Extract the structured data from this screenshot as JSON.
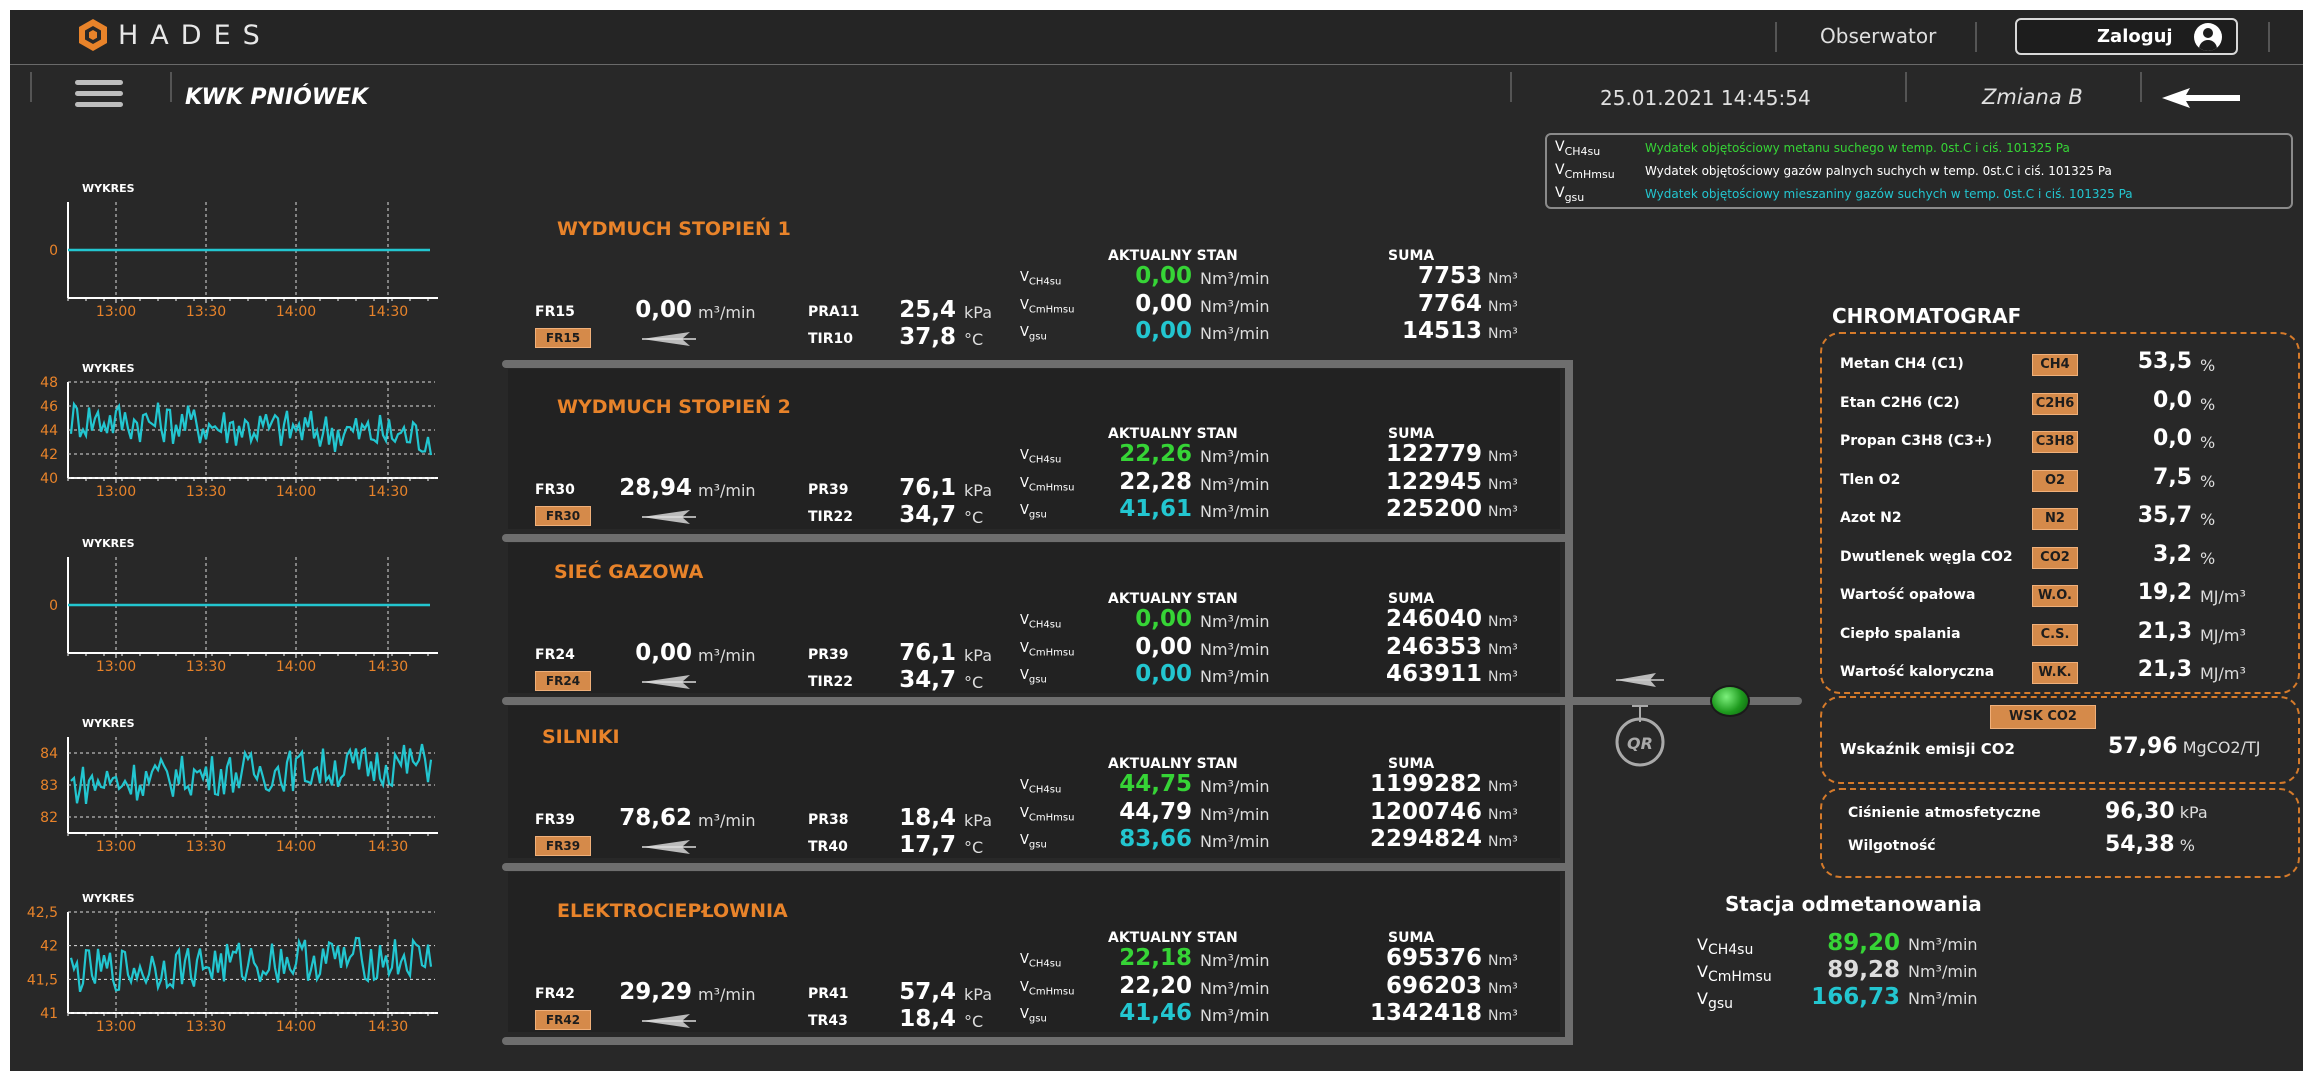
{
  "header": {
    "logo_text": "HADES",
    "role": "Obserwator",
    "login_label": "Zaloguj"
  },
  "subbar": {
    "mine": "KWK PNIÓWEK",
    "datetime": "25.01.2021 14:45:54",
    "shift": "Zmiana B"
  },
  "legend": [
    {
      "sym": "V",
      "sub": "CH4su",
      "text": "Wydatek objętościowy metanu suchego w temp. 0st.C i ciś. 101325 Pa",
      "color": "#36d436"
    },
    {
      "sym": "V",
      "sub": "CmHmsu",
      "text": "Wydatek objętościowy gazów palnych suchych w temp. 0st.C i ciś. 101325 Pa",
      "color": "#ffffff"
    },
    {
      "sym": "V",
      "sub": "gsu",
      "text": "Wydatek objętościowy mieszaniny gazów suchych w temp. 0st.C i ciś. 101325 Pa",
      "color": "#23c6d0"
    }
  ],
  "charts": [
    {
      "title": "WYKRES",
      "ticks_x": [
        "13:00",
        "13:30",
        "14:00",
        "14:30"
      ],
      "ticks_y": [
        "0"
      ]
    },
    {
      "title": "WYKRES",
      "ticks_x": [
        "13:00",
        "13:30",
        "14:00",
        "14:30"
      ],
      "ticks_y": [
        "48",
        "46",
        "44",
        "42",
        "40"
      ]
    },
    {
      "title": "WYKRES",
      "ticks_x": [
        "13:00",
        "13:30",
        "14:00",
        "14:30"
      ],
      "ticks_y": [
        "0"
      ]
    },
    {
      "title": "WYKRES",
      "ticks_x": [
        "13:00",
        "13:30",
        "14:00",
        "14:30"
      ],
      "ticks_y": [
        "84",
        "83",
        "82"
      ]
    },
    {
      "title": "WYKRES",
      "ticks_x": [
        "13:00",
        "13:30",
        "14:00",
        "14:30"
      ],
      "ticks_y": [
        "42,5",
        "42",
        "41,5",
        "41"
      ]
    }
  ],
  "chart_data": [
    {
      "type": "line",
      "title": "WYKRES",
      "x": [
        "13:00",
        "13:30",
        "14:00",
        "14:30"
      ],
      "ylim": [
        -1,
        1
      ],
      "series": [
        {
          "values": [
            0,
            0,
            0,
            0
          ]
        }
      ]
    },
    {
      "type": "line",
      "title": "WYKRES",
      "x": [
        "13:00",
        "13:30",
        "14:00",
        "14:30"
      ],
      "ylim": [
        40,
        48
      ],
      "series": [
        {
          "values": [
            45,
            44.5,
            44,
            43.5
          ]
        }
      ]
    },
    {
      "type": "line",
      "title": "WYKRES",
      "x": [
        "13:00",
        "13:30",
        "14:00",
        "14:30"
      ],
      "ylim": [
        -1,
        1
      ],
      "series": [
        {
          "values": [
            0,
            0,
            0,
            0
          ]
        }
      ]
    },
    {
      "type": "line",
      "title": "WYKRES",
      "x": [
        "13:00",
        "13:30",
        "14:00",
        "14:30"
      ],
      "ylim": [
        81.5,
        84.5
      ],
      "series": [
        {
          "values": [
            83,
            83.3,
            83.5,
            83.7
          ]
        }
      ]
    },
    {
      "type": "line",
      "title": "WYKRES",
      "x": [
        "13:00",
        "13:30",
        "14:00",
        "14:30"
      ],
      "ylim": [
        41,
        42.5
      ],
      "series": [
        {
          "values": [
            41.6,
            41.7,
            41.8,
            41.8
          ]
        }
      ]
    }
  ],
  "section_headers": {
    "state": "AKTUALNY STAN",
    "sum": "SUMA"
  },
  "sections": [
    {
      "title": "WYDMUCH STOPIEŃ 1",
      "flow_tag": "FR15",
      "flow_value": "0,00",
      "flow_unit": "m³/min",
      "p_tag": "PRA11",
      "p_value": "25,4",
      "p_unit": "kPa",
      "t_tag": "TIR10",
      "t_value": "37,8",
      "t_unit": "°C",
      "v_ch4": "0,00",
      "v_cm": "0,00",
      "v_gsu": "0,00",
      "v_unit": "Nm³/min",
      "s_ch4": "7753",
      "s_cm": "7764",
      "s_gsu": "14513",
      "s_unit": "Nm³"
    },
    {
      "title": "WYDMUCH STOPIEŃ 2",
      "flow_tag": "FR30",
      "flow_value": "28,94",
      "flow_unit": "m³/min",
      "p_tag": "PR39",
      "p_value": "76,1",
      "p_unit": "kPa",
      "t_tag": "TIR22",
      "t_value": "34,7",
      "t_unit": "°C",
      "v_ch4": "22,26",
      "v_cm": "22,28",
      "v_gsu": "41,61",
      "v_unit": "Nm³/min",
      "s_ch4": "122779",
      "s_cm": "122945",
      "s_gsu": "225200",
      "s_unit": "Nm³"
    },
    {
      "title": "SIEĆ GAZOWA",
      "flow_tag": "FR24",
      "flow_value": "0,00",
      "flow_unit": "m³/min",
      "p_tag": "PR39",
      "p_value": "76,1",
      "p_unit": "kPa",
      "t_tag": "TIR22",
      "t_value": "34,7",
      "t_unit": "°C",
      "v_ch4": "0,00",
      "v_cm": "0,00",
      "v_gsu": "0,00",
      "v_unit": "Nm³/min",
      "s_ch4": "246040",
      "s_cm": "246353",
      "s_gsu": "463911",
      "s_unit": "Nm³"
    },
    {
      "title": "SILNIKI",
      "flow_tag": "FR39",
      "flow_value": "78,62",
      "flow_unit": "m³/min",
      "p_tag": "PR38",
      "p_value": "18,4",
      "p_unit": "kPa",
      "t_tag": "TR40",
      "t_value": "17,7",
      "t_unit": "°C",
      "v_ch4": "44,75",
      "v_cm": "44,79",
      "v_gsu": "83,66",
      "v_unit": "Nm³/min",
      "s_ch4": "1199282",
      "s_cm": "1200746",
      "s_gsu": "2294824",
      "s_unit": "Nm³"
    },
    {
      "title": "ELEKTROCIEPŁOWNIA",
      "flow_tag": "FR42",
      "flow_value": "29,29",
      "flow_unit": "m³/min",
      "p_tag": "PR41",
      "p_value": "57,4",
      "p_unit": "kPa",
      "t_tag": "TR43",
      "t_value": "18,4",
      "t_unit": "°C",
      "v_ch4": "22,18",
      "v_cm": "22,20",
      "v_gsu": "41,46",
      "v_unit": "Nm³/min",
      "s_ch4": "695376",
      "s_cm": "696203",
      "s_gsu": "1342418",
      "s_unit": "Nm³"
    }
  ],
  "vsym": {
    "v": "V",
    "ch4": "CH4su",
    "cm": "CmHmsu",
    "gsu": "gsu"
  },
  "qr_label": "QR",
  "chromatograf": {
    "title": "CHROMATOGRAF",
    "rows": [
      {
        "label": "Metan CH4 (C1)",
        "tag": "CH4",
        "value": "53,5",
        "unit": "%"
      },
      {
        "label": "Etan C2H6 (C2)",
        "tag": "C2H6",
        "value": "0,0",
        "unit": "%"
      },
      {
        "label": "Propan C3H8 (C3+)",
        "tag": "C3H8",
        "value": "0,0",
        "unit": "%"
      },
      {
        "label": "Tlen O2",
        "tag": "O2",
        "value": "7,5",
        "unit": "%"
      },
      {
        "label": "Azot N2",
        "tag": "N2",
        "value": "35,7",
        "unit": "%"
      },
      {
        "label": "Dwutlenek węgla CO2",
        "tag": "CO2",
        "value": "3,2",
        "unit": "%"
      },
      {
        "label": "Wartość opałowa",
        "tag": "W.O.",
        "value": "19,2",
        "unit": "MJ/m³"
      },
      {
        "label": "Ciepło spalania",
        "tag": "C.S.",
        "value": "21,3",
        "unit": "MJ/m³"
      },
      {
        "label": "Wartość kaloryczna",
        "tag": "W.K.",
        "value": "21,3",
        "unit": "MJ/m³"
      }
    ]
  },
  "co2": {
    "tag": "WSK CO2",
    "label": "Wskaźnik emisji CO2",
    "value": "57,96",
    "unit": "MgCO2/TJ"
  },
  "atmo": [
    {
      "label": "Ciśnienie atmosfetyczne",
      "value": "96,30",
      "unit": "kPa"
    },
    {
      "label": "Wilgotność",
      "value": "54,38",
      "unit": "%"
    }
  ],
  "station": {
    "title": "Stacja odmetanowania",
    "v_ch4": "89,20",
    "v_cm": "89,28",
    "v_gsu": "166,73",
    "unit": "Nm³/min"
  }
}
